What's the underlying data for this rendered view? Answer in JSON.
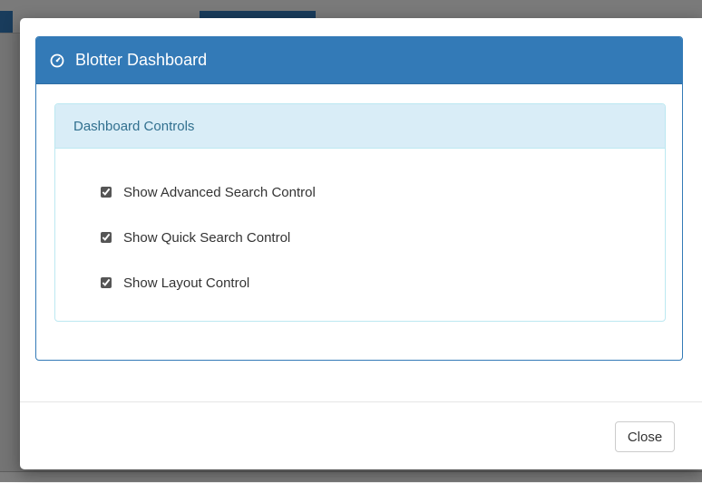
{
  "modal": {
    "title": "Blotter Dashboard",
    "title_icon": "dashboard-icon",
    "accent_color": "#337ab7"
  },
  "panel": {
    "title": "Dashboard Controls",
    "heading_color": "#d9edf7",
    "title_color": "#31708f"
  },
  "controls": [
    {
      "label": "Show Advanced Search Control",
      "checked": true
    },
    {
      "label": "Show Quick Search Control",
      "checked": true
    },
    {
      "label": "Show Layout Control",
      "checked": true
    }
  ],
  "footer": {
    "close_label": "Close"
  }
}
